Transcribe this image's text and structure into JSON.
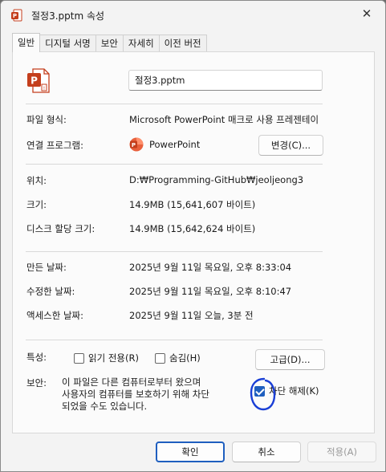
{
  "window": {
    "title": "절정3.pptm 속성",
    "close_glyph": "✕"
  },
  "tabs": [
    {
      "label": "일반"
    },
    {
      "label": "디지털 서명"
    },
    {
      "label": "보안"
    },
    {
      "label": "자세히"
    },
    {
      "label": "이전 버전"
    }
  ],
  "general": {
    "filename": "절정3.pptm",
    "file_type_label": "파일 형식:",
    "file_type_value": "Microsoft PowerPoint 매크로 사용 프레젠테이",
    "opens_with_label": "연결 프로그램:",
    "opens_with_value": "PowerPoint",
    "change_button": "변경(C)...",
    "location_label": "위치:",
    "location_value": "D:₩Programming-GitHub₩jeoljeong3",
    "size_label": "크기:",
    "size_value": "14.9MB (15,641,607 바이트)",
    "size_on_disk_label": "디스크 할당 크기:",
    "size_on_disk_value": "14.9MB (15,642,624 바이트)",
    "created_label": "만든 날짜:",
    "created_value": "2025년 9월 11일 목요일, 오후 8:33:04",
    "modified_label": "수정한 날짜:",
    "modified_value": "2025년 9월 11일 목요일, 오후 8:10:47",
    "accessed_label": "액세스한 날짜:",
    "accessed_value": "2025년 9월 11일 오늘, 3분 전",
    "attributes_label": "특성:",
    "readonly_label": "읽기 전용(R)",
    "hidden_label": "숨김(H)",
    "advanced_button": "고급(D)...",
    "security_label": "보안:",
    "security_text": [
      "이 파일은 다른 컴퓨터로부터 왔으며",
      "사용자의 컴퓨터를 보호하기 위해 차단",
      "되었을 수도 있습니다."
    ],
    "unblock_label": "차단 해제(K)",
    "unblock_checked": true
  },
  "footer": {
    "ok": "확인",
    "cancel": "취소",
    "apply": "적용(A)"
  },
  "colors": {
    "accent": "#1f5fbf",
    "ppt_orange": "#c43e1c",
    "annotation": "#1a3fd6"
  }
}
